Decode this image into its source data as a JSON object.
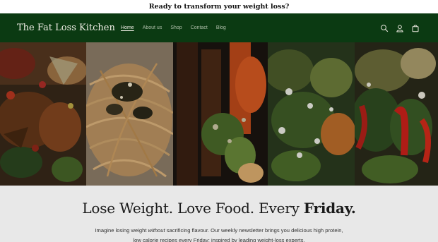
{
  "announcement": "Ready to transform your weight loss?",
  "brand": "The Fat Loss Kitchen",
  "nav": [
    "Home",
    "About us",
    "Shop",
    "Contact",
    "Blog"
  ],
  "nav_active": "Home",
  "header_icons": [
    "search-icon",
    "account-icon",
    "cart-icon"
  ],
  "hero": {
    "panels": [
      "food-image-spiced-chicken",
      "food-image-noodles",
      "food-image-stirfry",
      "food-image-broccoli-salad",
      "food-image-pepper-salad"
    ]
  },
  "promo": {
    "headline_prefix": "Lose Weight. Love Food. Every ",
    "headline_emphasis": "Friday.",
    "paragraph_start": "Imagine losing weight ",
    "paragraph_emphasis": "without",
    "paragraph_rest": " sacrificing flavour. Our weekly newsletter brings you delicious high protein, low calorie recipes every Friday; inspired by leading weight-loss experts."
  },
  "colors": {
    "header_bg": "#0b3a12",
    "announcement_bg": "#ffffff",
    "promo_bg": "#e8e8e8"
  }
}
